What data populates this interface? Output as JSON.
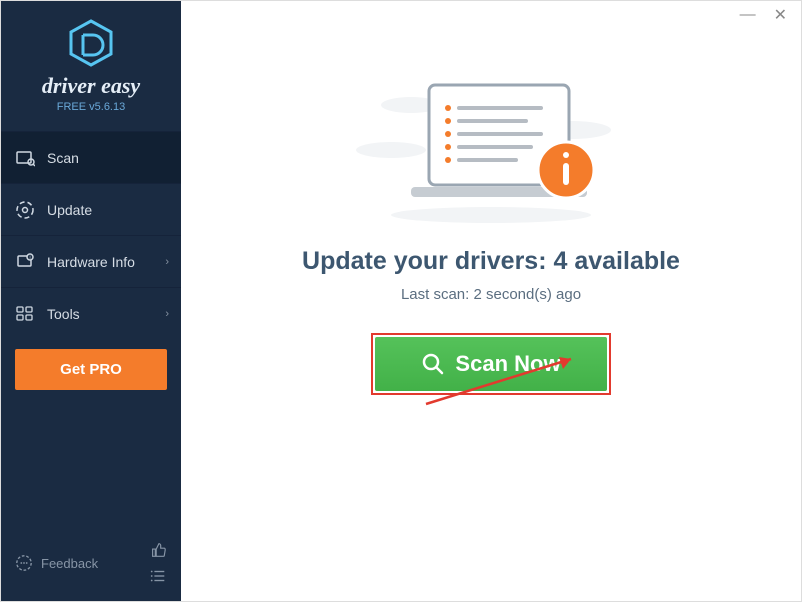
{
  "brand": {
    "name": "driver easy",
    "version": "FREE v5.6.13"
  },
  "nav": {
    "scan": "Scan",
    "update": "Update",
    "hardware": "Hardware Info",
    "tools": "Tools"
  },
  "getpro": "Get PRO",
  "feedback": "Feedback",
  "main": {
    "headline_prefix": "Update your drivers: ",
    "available_count": "4",
    "headline_suffix": " available",
    "last_scan": "Last scan: 2 second(s) ago",
    "scan_button": "Scan Now"
  }
}
